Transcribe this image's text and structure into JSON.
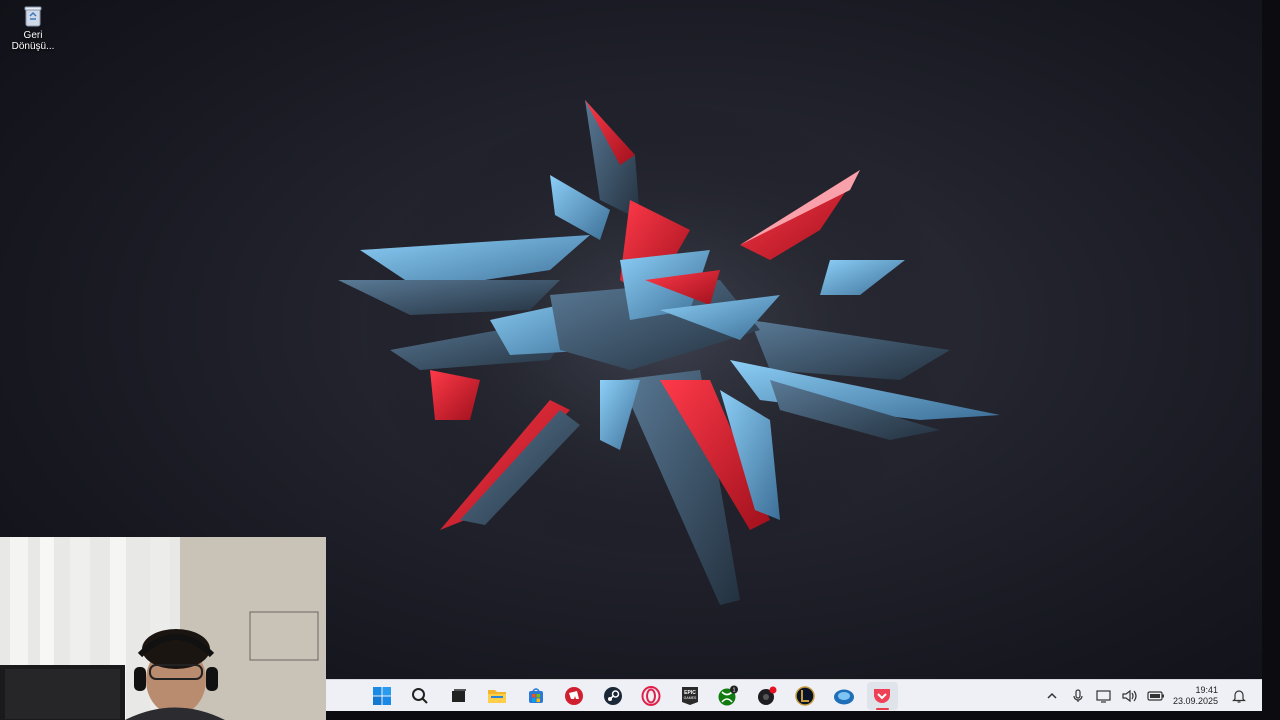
{
  "desktop": {
    "icons": [
      {
        "label": "Geri Dönüşü...",
        "icon": "recycle-bin-icon"
      }
    ]
  },
  "taskbar": {
    "apps": [
      {
        "name": "start",
        "icon": "windows-start-icon"
      },
      {
        "name": "search",
        "icon": "search-icon"
      },
      {
        "name": "task-view",
        "icon": "task-view-icon"
      },
      {
        "name": "file-explorer",
        "icon": "folder-icon"
      },
      {
        "name": "microsoft-store",
        "icon": "store-icon"
      },
      {
        "name": "riot-client",
        "icon": "riot-icon"
      },
      {
        "name": "steam",
        "icon": "steam-icon"
      },
      {
        "name": "opera-gx",
        "icon": "opera-icon"
      },
      {
        "name": "epic-games",
        "icon": "epic-games-icon",
        "label": "EPIC\nGAMES"
      },
      {
        "name": "xbox",
        "icon": "xbox-icon",
        "badge": "1"
      },
      {
        "name": "app-dark",
        "icon": "dark-app-icon"
      },
      {
        "name": "league-of-legends",
        "icon": "league-icon"
      },
      {
        "name": "app-blue",
        "icon": "blue-orb-icon"
      },
      {
        "name": "pocket",
        "icon": "pocket-icon",
        "active": true
      }
    ],
    "tray": {
      "icons": [
        "chevron-up-icon",
        "microphone-icon",
        "display-icon",
        "speaker-icon",
        "battery-icon"
      ],
      "time": "19:41",
      "date": "23.09.2025"
    }
  },
  "colors": {
    "accent_red": "#e83b4c",
    "shard_blue": "#6fb6ea",
    "taskbar_bg": "#eef0f5"
  }
}
